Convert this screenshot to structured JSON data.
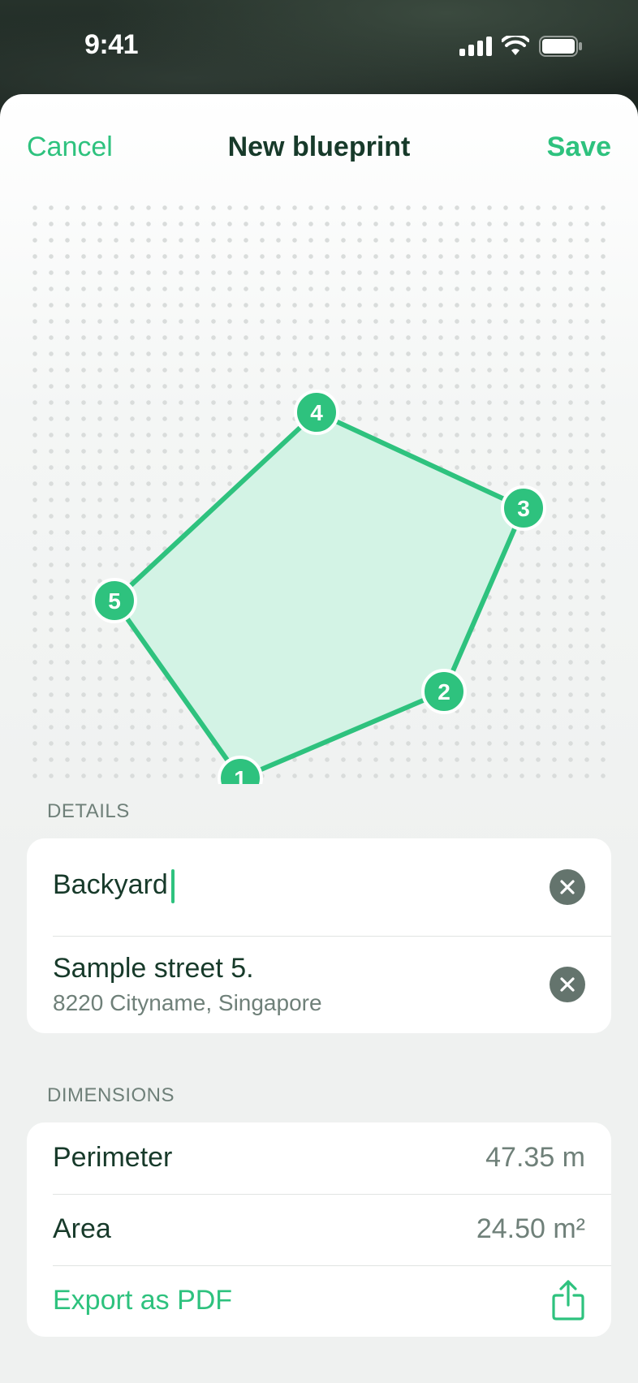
{
  "status_bar": {
    "time": "9:41",
    "icons": [
      "cellular-signal-icon",
      "wifi-icon",
      "battery-icon"
    ]
  },
  "navbar": {
    "cancel_label": "Cancel",
    "title": "New blueprint",
    "save_label": "Save"
  },
  "blueprint": {
    "accent": "#2ec27e",
    "fill": "#d3f3e5",
    "points": [
      {
        "label": "1"
      },
      {
        "label": "2"
      },
      {
        "label": "3"
      },
      {
        "label": "4"
      },
      {
        "label": "5"
      }
    ]
  },
  "details": {
    "header": "DETAILS",
    "name_value": "Backyard",
    "address_line1": "Sample street 5.",
    "address_line2": "8220 Cityname, Singapore"
  },
  "dimensions": {
    "header": "DIMENSIONS",
    "perimeter_label": "Perimeter",
    "perimeter_value": "47.35 m",
    "area_label": "Area",
    "area_value": "24.50 m²",
    "export_label": "Export as PDF",
    "export_icon": "share-icon"
  },
  "colors": {
    "accent": "#2ec27e",
    "title": "#173a2a",
    "secondary": "#6f8079"
  }
}
